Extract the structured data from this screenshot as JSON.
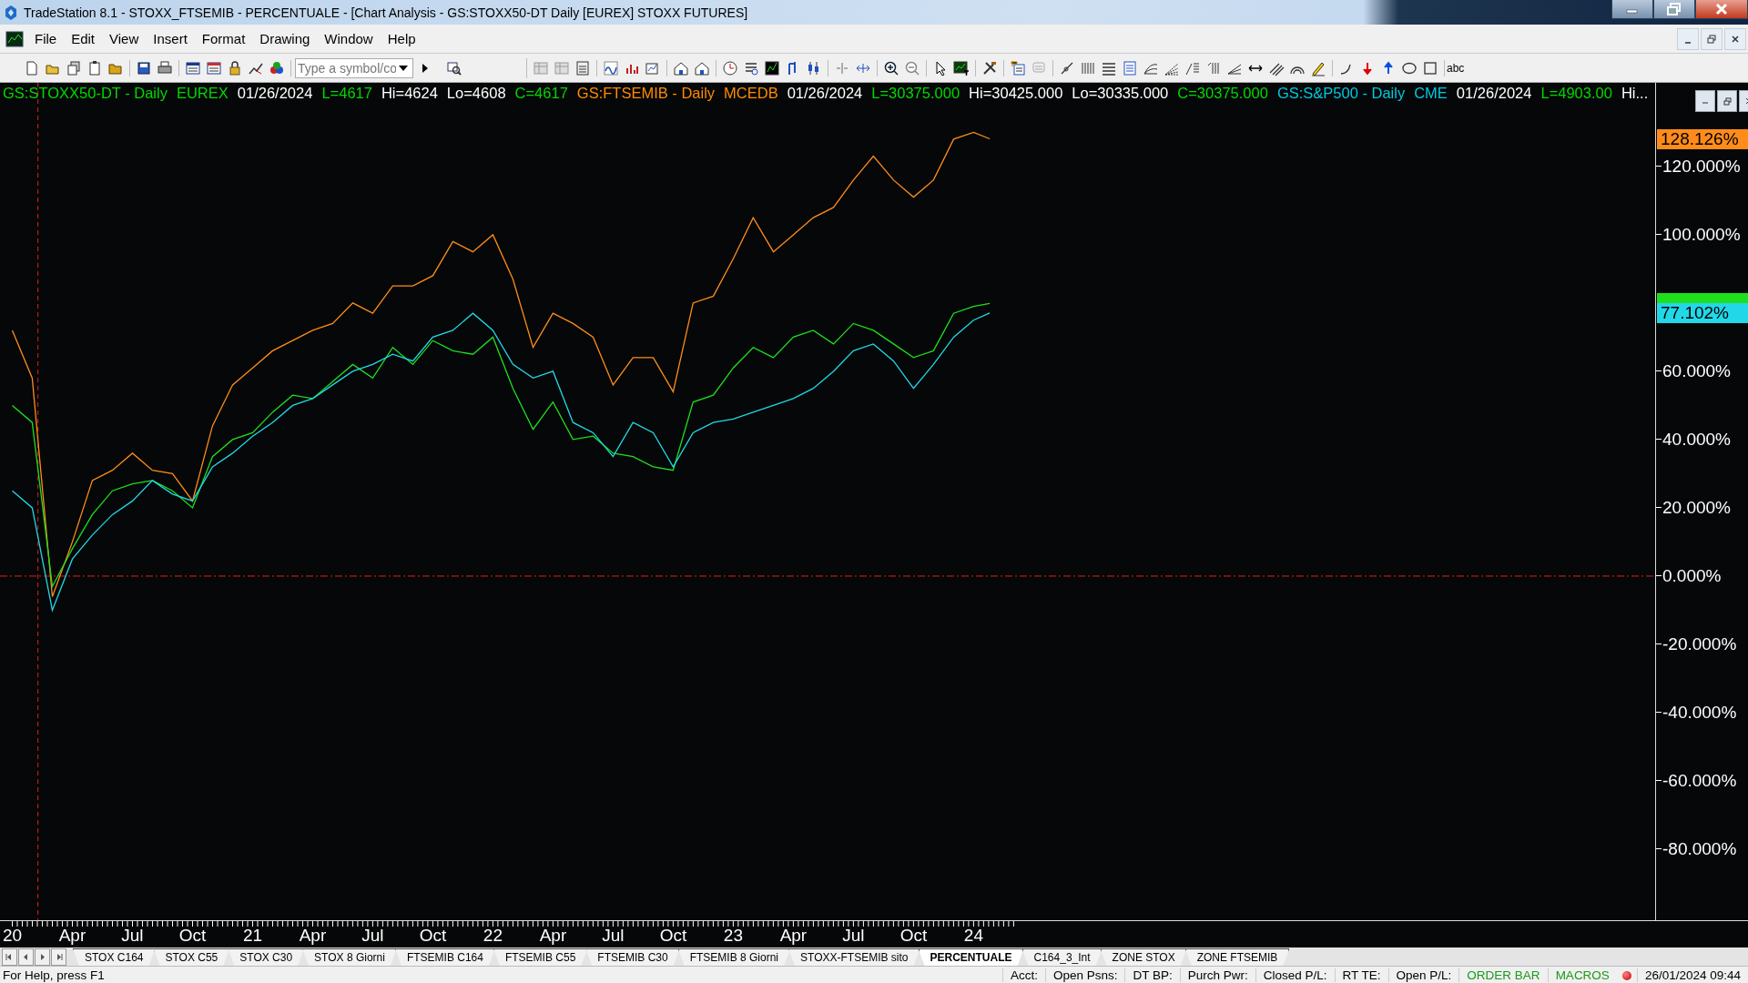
{
  "window": {
    "title": "TradeStation 8.1 - STOXX_FTSEMIB - PERCENTUALE - [Chart Analysis - GS:STOXX50-DT  Daily  [EUREX] STOXX FUTURES]"
  },
  "menu": [
    "File",
    "Edit",
    "View",
    "Insert",
    "Format",
    "Drawing",
    "Window",
    "Help"
  ],
  "toolbar": {
    "symbol_field": {
      "placeholder": "Type a symbol/co"
    },
    "text_tool": "abc"
  },
  "chart": {
    "info_line": [
      {
        "text": "GS:STOXX50-DT - Daily",
        "color": "#00d800"
      },
      {
        "text": "EUREX",
        "color": "#00d800"
      },
      {
        "text": "01/26/2024",
        "color": "#ffffff"
      },
      {
        "text": "L=4617",
        "color": "#00d800"
      },
      {
        "text": "Hi=4624",
        "color": "#ffffff"
      },
      {
        "text": "Lo=4608",
        "color": "#ffffff"
      },
      {
        "text": "C=4617",
        "color": "#00d800"
      },
      {
        "text": "GS:FTSEMIB - Daily",
        "color": "#ff8c00"
      },
      {
        "text": "MCEDB",
        "color": "#ff8c00"
      },
      {
        "text": "01/26/2024",
        "color": "#ffffff"
      },
      {
        "text": "L=30375.000",
        "color": "#00d800"
      },
      {
        "text": "Hi=30425.000",
        "color": "#ffffff"
      },
      {
        "text": "Lo=30335.000",
        "color": "#ffffff"
      },
      {
        "text": "C=30375.000",
        "color": "#00d800"
      },
      {
        "text": "GS:S&P500 - Daily",
        "color": "#00c8e0"
      },
      {
        "text": "CME",
        "color": "#00c8e0"
      },
      {
        "text": "01/26/2024",
        "color": "#ffffff"
      },
      {
        "text": "L=4903.00",
        "color": "#00d800"
      },
      {
        "text": "Hi...",
        "color": "#ffffff"
      }
    ],
    "price_markers": [
      {
        "text": "128.126%",
        "color": "#ff8c1a"
      },
      {
        "color": "#1ee01e"
      },
      {
        "text": "77.102%",
        "color": "#22d8e8"
      }
    ],
    "chart_data": {
      "type": "line",
      "xlim": [
        19.949,
        27.222
      ],
      "ref_lines": [
        {
          "axis": "y",
          "value": 0,
          "color": "#e02020"
        },
        {
          "axis": "x",
          "value": 20.107,
          "color": "#e02020"
        }
      ],
      "ylim": [
        -100.8,
        144.5
      ],
      "x": [
        20,
        20.083,
        20.167,
        20.25,
        20.333,
        20.417,
        20.5,
        20.583,
        20.667,
        20.75,
        20.833,
        20.917,
        21,
        21.083,
        21.167,
        21.25,
        21.333,
        21.417,
        21.5,
        21.583,
        21.667,
        21.75,
        21.833,
        21.917,
        22,
        22.083,
        22.167,
        22.25,
        22.333,
        22.417,
        22.5,
        22.583,
        22.667,
        22.75,
        22.833,
        22.917,
        23,
        23.083,
        23.167,
        23.25,
        23.333,
        23.417,
        23.5,
        23.583,
        23.667,
        23.75,
        23.833,
        23.917,
        24,
        24.067
      ],
      "xticks": [
        {
          "value": 20,
          "label": "20"
        },
        {
          "value": 20.25,
          "label": "Apr"
        },
        {
          "value": 20.5,
          "label": "Jul"
        },
        {
          "value": 20.75,
          "label": "Oct"
        },
        {
          "value": 21,
          "label": "21"
        },
        {
          "value": 21.25,
          "label": "Apr"
        },
        {
          "value": 21.5,
          "label": "Jul"
        },
        {
          "value": 21.75,
          "label": "Oct"
        },
        {
          "value": 22,
          "label": "22"
        },
        {
          "value": 22.25,
          "label": "Apr"
        },
        {
          "value": 22.5,
          "label": "Jul"
        },
        {
          "value": 22.75,
          "label": "Oct"
        },
        {
          "value": 23,
          "label": "23"
        },
        {
          "value": 23.25,
          "label": "Apr"
        },
        {
          "value": 23.5,
          "label": "Jul"
        },
        {
          "value": 23.75,
          "label": "Oct"
        },
        {
          "value": 24,
          "label": "24"
        }
      ],
      "yticks": [
        {
          "value": 120,
          "label": "120.000%"
        },
        {
          "value": 100,
          "label": "100.000%"
        },
        {
          "value": 60,
          "label": "60.000%"
        },
        {
          "value": 40,
          "label": "40.000%"
        },
        {
          "value": 20,
          "label": "20.000%"
        },
        {
          "value": 0,
          "label": "0.000%"
        },
        {
          "value": -20,
          "label": "-20.000%"
        },
        {
          "value": -40,
          "label": "-40.000%"
        },
        {
          "value": -60,
          "label": "-60.000%"
        },
        {
          "value": -80,
          "label": "-80.000%"
        }
      ],
      "series": [
        {
          "color": "#ff8c1a",
          "values": [
            72,
            58,
            -6,
            10,
            28,
            31,
            36,
            31,
            30,
            22,
            44,
            56,
            61,
            66,
            69,
            72,
            74,
            80,
            77,
            85,
            85,
            88,
            98,
            95,
            100,
            87,
            67,
            77,
            74,
            70,
            56,
            64,
            64,
            54,
            80,
            82,
            93,
            105,
            95,
            100,
            105,
            108,
            116,
            123,
            116,
            111,
            116,
            128,
            130,
            128.1
          ]
        },
        {
          "color": "#1ee01e",
          "values": [
            50,
            45,
            -3,
            8,
            18,
            25,
            27,
            28,
            25,
            20,
            35,
            40,
            42,
            48,
            53,
            52,
            57,
            62,
            58,
            67,
            62,
            69,
            66,
            65,
            70,
            55,
            43,
            51,
            40,
            41,
            36,
            35,
            32,
            31,
            51,
            53,
            61,
            67,
            64,
            70,
            72,
            68,
            74,
            72,
            68,
            64,
            66,
            77,
            79,
            79.9
          ]
        },
        {
          "color": "#22d8e8",
          "values": [
            25,
            20,
            -10,
            5,
            12,
            18,
            22,
            28,
            24,
            22,
            32,
            36,
            41,
            45,
            50,
            52,
            56,
            60,
            62,
            65,
            63,
            70,
            72,
            77,
            72,
            62,
            58,
            60,
            45,
            42,
            35,
            45,
            42,
            32,
            42,
            45,
            46,
            48,
            50,
            52,
            55,
            60,
            66,
            68,
            63,
            55,
            62,
            70,
            75,
            77.1
          ]
        }
      ]
    }
  },
  "sheet_tabs": [
    {
      "label": "STOX C164",
      "selected": false
    },
    {
      "label": "STOX C55",
      "selected": false
    },
    {
      "label": "STOX  C30",
      "selected": false
    },
    {
      "label": "STOX  8 Giorni",
      "selected": false
    },
    {
      "label": "FTSEMIB C164",
      "selected": false
    },
    {
      "label": "FTSEMIB C55",
      "selected": false
    },
    {
      "label": "FTSEMIB C30",
      "selected": false
    },
    {
      "label": "FTSEMIB  8 Giorni",
      "selected": false
    },
    {
      "label": "STOXX-FTSEMIB sito",
      "selected": false
    },
    {
      "label": "PERCENTUALE",
      "selected": true
    },
    {
      "label": "C164_3_Int",
      "selected": false
    },
    {
      "label": "ZONE STOX",
      "selected": false
    },
    {
      "label": "ZONE FTSEMIB",
      "selected": false
    }
  ],
  "status_bar": {
    "help": "For Help, press F1",
    "fields": [
      {
        "text": "Acct:",
        "color": "#000000"
      },
      {
        "text": "Open Psns:",
        "color": "#000000"
      },
      {
        "text": "DT BP:",
        "color": "#000000"
      },
      {
        "text": "Purch Pwr:",
        "color": "#000000"
      },
      {
        "text": "Closed P/L:",
        "color": "#000000"
      },
      {
        "text": "RT TE:",
        "color": "#000000"
      },
      {
        "text": "Open P/L:",
        "color": "#000000"
      },
      {
        "text": "ORDER BAR",
        "color": "#1a9a1a"
      },
      {
        "text": "MACROS",
        "color": "#1a9a1a"
      }
    ],
    "datetime": "26/01/2024 09:44"
  }
}
